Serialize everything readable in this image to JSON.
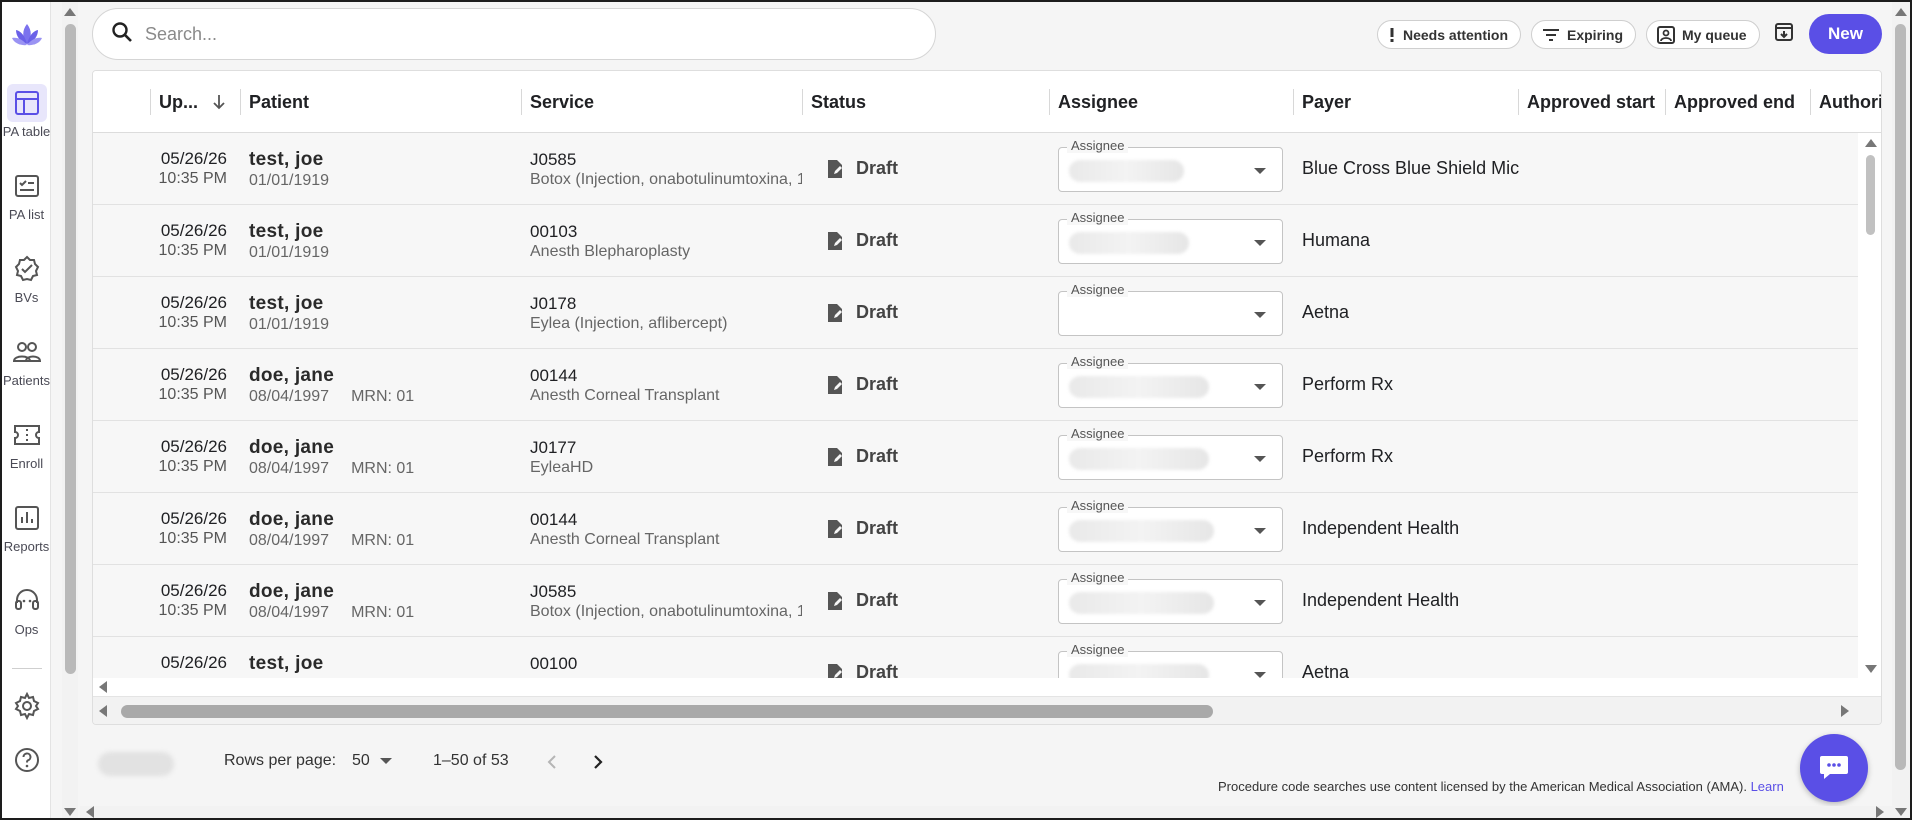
{
  "nav": {
    "items": [
      {
        "label": "PA table",
        "icon": "table-icon",
        "active": true
      },
      {
        "label": "PA list",
        "icon": "checklist-icon",
        "active": false
      },
      {
        "label": "BVs",
        "icon": "verified-badge-icon",
        "active": false
      },
      {
        "label": "Patients",
        "icon": "people-icon",
        "active": false
      },
      {
        "label": "Enroll",
        "icon": "ticket-icon",
        "active": false
      },
      {
        "label": "Reports",
        "icon": "bar-chart-icon",
        "active": false
      },
      {
        "label": "Ops",
        "icon": "headset-icon",
        "active": false
      }
    ],
    "bottom": [
      {
        "icon": "gear-icon"
      },
      {
        "icon": "help-icon"
      }
    ]
  },
  "search": {
    "placeholder": "Search..."
  },
  "filters": {
    "needs_attention": "Needs attention",
    "expiring": "Expiring",
    "my_queue": "My queue"
  },
  "new_button": "New",
  "colors": {
    "accent": "#5a4fe6",
    "accent_light": "#e8e6fb"
  },
  "table": {
    "columns": [
      "Up...",
      "Patient",
      "Service",
      "Status",
      "Assignee",
      "Payer",
      "Approved start",
      "Approved end",
      "Authori"
    ],
    "assignee_label": "Assignee",
    "rows": [
      {
        "date": "05/26/26",
        "time": "10:35 PM",
        "patient": "test, joe",
        "dob": "01/01/1919",
        "mrn": "",
        "code": "J0585",
        "desc": "Botox (Injection, onabotulinumtoxina, 1",
        "status": "Draft",
        "payer": "Blue Cross Blue Shield Mic"
      },
      {
        "date": "05/26/26",
        "time": "10:35 PM",
        "patient": "test, joe",
        "dob": "01/01/1919",
        "mrn": "",
        "code": "00103",
        "desc": "Anesth Blepharoplasty",
        "status": "Draft",
        "payer": "Humana"
      },
      {
        "date": "05/26/26",
        "time": "10:35 PM",
        "patient": "test, joe",
        "dob": "01/01/1919",
        "mrn": "",
        "code": "J0178",
        "desc": "Eylea (Injection, aflibercept)",
        "status": "Draft",
        "payer": "Aetna"
      },
      {
        "date": "05/26/26",
        "time": "10:35 PM",
        "patient": "doe, jane",
        "dob": "08/04/1997",
        "mrn": "MRN: 01",
        "code": "00144",
        "desc": "Anesth Corneal Transplant",
        "status": "Draft",
        "payer": "Perform Rx"
      },
      {
        "date": "05/26/26",
        "time": "10:35 PM",
        "patient": "doe, jane",
        "dob": "08/04/1997",
        "mrn": "MRN: 01",
        "code": "J0177",
        "desc": "EyleaHD",
        "status": "Draft",
        "payer": "Perform Rx"
      },
      {
        "date": "05/26/26",
        "time": "10:35 PM",
        "patient": "doe, jane",
        "dob": "08/04/1997",
        "mrn": "MRN: 01",
        "code": "00144",
        "desc": "Anesth Corneal Transplant",
        "status": "Draft",
        "payer": "Independent Health"
      },
      {
        "date": "05/26/26",
        "time": "10:35 PM",
        "patient": "doe, jane",
        "dob": "08/04/1997",
        "mrn": "MRN: 01",
        "code": "J0585",
        "desc": "Botox (Injection, onabotulinumtoxina, 1",
        "status": "Draft",
        "payer": "Independent Health"
      },
      {
        "date": "05/26/26",
        "time": "",
        "patient": "test, joe",
        "dob": "",
        "mrn": "",
        "code": "00100",
        "desc": "",
        "status": "Draft",
        "payer": "Aetna"
      }
    ]
  },
  "pagination": {
    "rows_per_page_label": "Rows per page:",
    "rows_per_page": "50",
    "range": "1–50 of 53"
  },
  "footer": {
    "ama_text": "Procedure code searches use content licensed by the American Medical Association (AMA).",
    "learn_link": "Learn"
  }
}
